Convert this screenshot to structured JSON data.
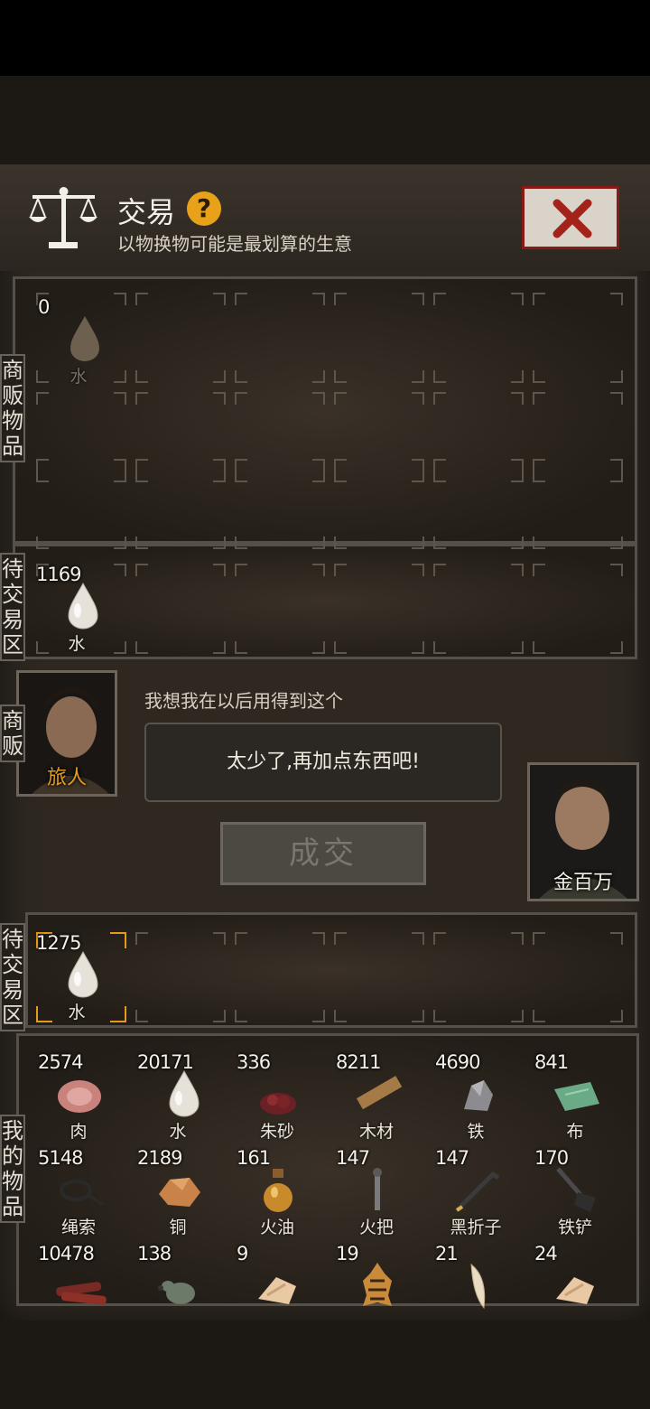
{
  "header": {
    "title": "交易",
    "help": "?",
    "subtitle": "以物换物可能是最划算的生意"
  },
  "labels": {
    "merchant_goods": "商贩物品",
    "pending_top": "待交易区",
    "merchant": "商贩",
    "pending_bottom": "待交易区",
    "my_goods": "我的物品"
  },
  "merchant_goods": [
    {
      "count": "0",
      "name": "水",
      "icon": "water-drop-icon"
    }
  ],
  "pending_top": [
    {
      "count": "1169",
      "name": "水",
      "icon": "water-drop-icon"
    }
  ],
  "merchant": {
    "name": "旅人",
    "wish": "我想我在以后用得到这个",
    "reply": "太少了,再加点东西吧!"
  },
  "player": {
    "name": "金百万"
  },
  "deal_button": "成交",
  "pending_bottom": [
    {
      "count": "1275",
      "name": "水",
      "icon": "water-drop-icon"
    }
  ],
  "inventory": [
    {
      "count": "2574",
      "name": "肉",
      "icon": "meat-icon"
    },
    {
      "count": "20171",
      "name": "水",
      "icon": "water-drop-icon"
    },
    {
      "count": "336",
      "name": "朱砂",
      "icon": "cinnabar-icon"
    },
    {
      "count": "8211",
      "name": "木材",
      "icon": "wood-plank-icon"
    },
    {
      "count": "4690",
      "name": "铁",
      "icon": "iron-ore-icon"
    },
    {
      "count": "841",
      "name": "布",
      "icon": "cloth-icon"
    },
    {
      "count": "5148",
      "name": "绳索",
      "icon": "rope-icon"
    },
    {
      "count": "2189",
      "name": "铜",
      "icon": "copper-ore-icon"
    },
    {
      "count": "161",
      "name": "火油",
      "icon": "oil-bottle-icon"
    },
    {
      "count": "147",
      "name": "火把",
      "icon": "torch-icon"
    },
    {
      "count": "147",
      "name": "黑折子",
      "icon": "crowbar-icon"
    },
    {
      "count": "170",
      "name": "铁铲",
      "icon": "shovel-icon"
    },
    {
      "count": "10478",
      "name": "",
      "icon": "jerky-icon"
    },
    {
      "count": "138",
      "name": "",
      "icon": "gourd-icon"
    },
    {
      "count": "9",
      "name": "",
      "icon": "animal-bone-icon"
    },
    {
      "count": "19",
      "name": "",
      "icon": "tiger-pelt-icon"
    },
    {
      "count": "21",
      "name": "",
      "icon": "fang-icon"
    },
    {
      "count": "24",
      "name": "",
      "icon": "animal-bone-icon"
    }
  ],
  "colors": {
    "accent": "#e59a1f",
    "close_red": "#8a1a14",
    "panel_bg": "#2e2821"
  }
}
